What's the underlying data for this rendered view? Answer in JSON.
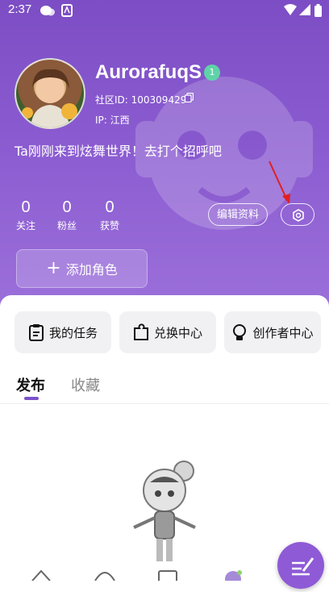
{
  "status_bar": {
    "time": "2:37"
  },
  "profile": {
    "username": "AurorafuqS",
    "level": "1",
    "community_id": "社区ID: 100309429",
    "ip": "IP:  江西",
    "bio": "Ta刚刚来到炫舞世界！去打个招呼吧"
  },
  "stats": [
    {
      "value": "0",
      "label": "关注"
    },
    {
      "value": "0",
      "label": "粉丝"
    },
    {
      "value": "0",
      "label": "获赞"
    }
  ],
  "buttons": {
    "edit_profile": "编辑资料",
    "add_role": "添加角色"
  },
  "quick_actions": [
    {
      "label": "我的任务",
      "icon": "clipboard-icon"
    },
    {
      "label": "兑换中心",
      "icon": "puzzle-icon"
    },
    {
      "label": "创作者中心",
      "icon": "lightbulb-icon"
    }
  ],
  "tabs": [
    {
      "label": "发布",
      "active": true
    },
    {
      "label": "收藏",
      "active": false
    }
  ],
  "colors": {
    "brand_purple": "#8a5bd0",
    "badge_green": "#5fd3a8",
    "tab_indicator": "#7b52c8"
  }
}
